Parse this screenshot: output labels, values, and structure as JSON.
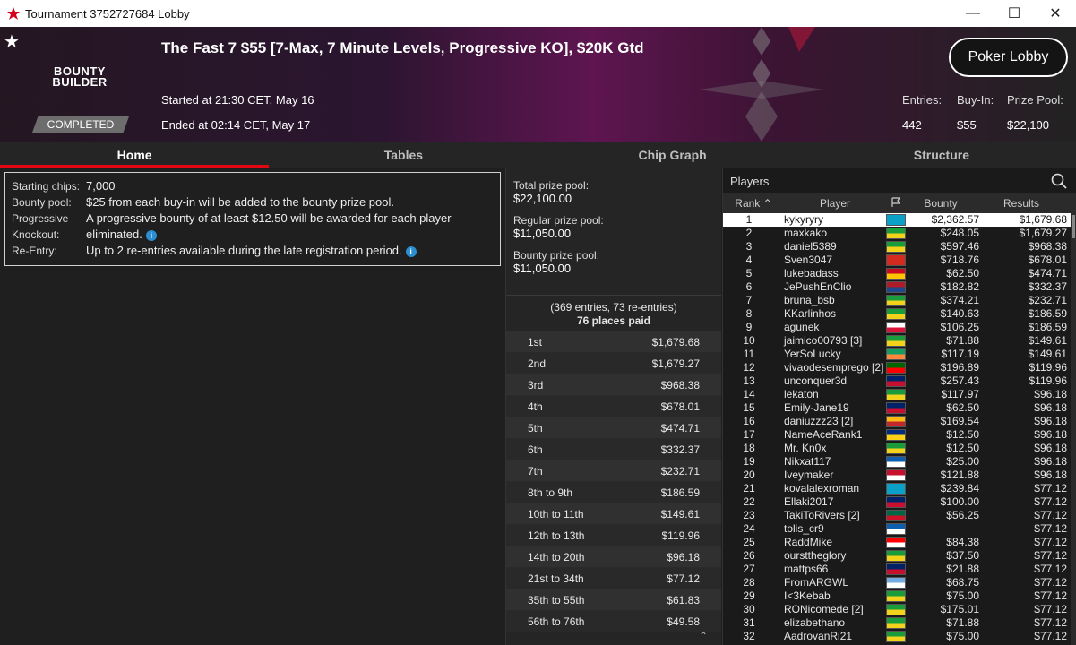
{
  "window": {
    "title": "Tournament 3752727684 Lobby",
    "minimize": "—",
    "maximize": "☐",
    "close": "✕"
  },
  "banner": {
    "favorite": "★",
    "brand_line1": "BOUNTY",
    "brand_line2": "BUILDER",
    "status": "COMPLETED",
    "title": "The Fast 7 $55 [7-Max, 7 Minute Levels, Progressive KO], $20K Gtd",
    "started": "Started at 21:30 CET, May 16",
    "ended": "Ended at 02:14 CET, May 17",
    "lobby_button": "Poker Lobby",
    "stats": {
      "entries_label": "Entries:",
      "buyin_label": "Buy-In:",
      "prize_label": "Prize Pool:",
      "entries": "442",
      "buyin": "$55",
      "prize": "$22,100"
    }
  },
  "tabs": [
    {
      "label": "Home",
      "active": true
    },
    {
      "label": "Tables",
      "active": false
    },
    {
      "label": "Chip Graph",
      "active": false
    },
    {
      "label": "Structure",
      "active": false
    }
  ],
  "info": {
    "starting_label": "Starting chips:",
    "starting_value": "7,000",
    "bounty_label": "Bounty pool:",
    "bounty_value": "$25 from each buy-in will be added to the bounty prize pool.",
    "pko_label_1": "Progressive",
    "pko_label_2": "Knockout:",
    "pko_value": "A progressive bounty of at least $12.50 will be awarded for each player eliminated.",
    "reentry_label": "Re-Entry:",
    "reentry_value": "Up to 2 re-entries available during the late registration period.",
    "info_icon": "i"
  },
  "prize": {
    "total_label": "Total prize pool:",
    "total_value": "$22,100.00",
    "regular_label": "Regular prize pool:",
    "regular_value": "$11,050.00",
    "bounty_label": "Bounty prize pool:",
    "bounty_value": "$11,050.00",
    "entries_note": "(369 entries, 73 re-entries)",
    "places_paid": "76 places paid",
    "scroll_up": "⌃",
    "places": [
      {
        "place": "1st",
        "amount": "$1,679.68"
      },
      {
        "place": "2nd",
        "amount": "$1,679.27"
      },
      {
        "place": "3rd",
        "amount": "$968.38"
      },
      {
        "place": "4th",
        "amount": "$678.01"
      },
      {
        "place": "5th",
        "amount": "$474.71"
      },
      {
        "place": "6th",
        "amount": "$332.37"
      },
      {
        "place": "7th",
        "amount": "$232.71"
      },
      {
        "place": "8th to 9th",
        "amount": "$186.59"
      },
      {
        "place": "10th to 11th",
        "amount": "$149.61"
      },
      {
        "place": "12th to 13th",
        "amount": "$119.96"
      },
      {
        "place": "14th to 20th",
        "amount": "$96.18"
      },
      {
        "place": "21st to 34th",
        "amount": "$77.12"
      },
      {
        "place": "35th to 55th",
        "amount": "$61.83"
      },
      {
        "place": "56th to 76th",
        "amount": "$49.58"
      }
    ]
  },
  "players": {
    "title": "Players",
    "cols": {
      "rank": "Rank",
      "player": "Player",
      "bounty": "Bounty",
      "results": "Results"
    },
    "rows": [
      {
        "rank": "1",
        "name": "kykyryry",
        "bounty": "$2,362.57",
        "result": "$1,679.68",
        "flag": [
          "#0aa0c8",
          "#0aa0c8"
        ]
      },
      {
        "rank": "2",
        "name": "maxkako",
        "bounty": "$248.05",
        "result": "$1,679.27",
        "flag": [
          "#1a9c3a",
          "#f2d21b"
        ]
      },
      {
        "rank": "3",
        "name": "daniel5389",
        "bounty": "$597.46",
        "result": "$968.38",
        "flag": [
          "#1a9c3a",
          "#f2d21b"
        ]
      },
      {
        "rank": "4",
        "name": "Sven3047",
        "bounty": "$718.76",
        "result": "$678.01",
        "flag": [
          "#d52b1e",
          "#d52b1e"
        ]
      },
      {
        "rank": "5",
        "name": "lukebadass",
        "bounty": "$62.50",
        "result": "$474.71",
        "flag": [
          "#c60b1e",
          "#ffc400"
        ]
      },
      {
        "rank": "6",
        "name": "JePushEnClio",
        "bounty": "$182.82",
        "result": "$332.37",
        "flag": [
          "#ae1c28",
          "#21468b"
        ]
      },
      {
        "rank": "7",
        "name": "bruna_bsb",
        "bounty": "$374.21",
        "result": "$232.71",
        "flag": [
          "#1a9c3a",
          "#f2d21b"
        ]
      },
      {
        "rank": "8",
        "name": "KKarlinhos",
        "bounty": "$140.63",
        "result": "$186.59",
        "flag": [
          "#1a9c3a",
          "#f2d21b"
        ]
      },
      {
        "rank": "9",
        "name": "agunek",
        "bounty": "$106.25",
        "result": "$186.59",
        "flag": [
          "#ffffff",
          "#dc143c"
        ]
      },
      {
        "rank": "10",
        "name": "jaimico00793 [3]",
        "bounty": "$71.88",
        "result": "$149.61",
        "flag": [
          "#1a9c3a",
          "#f2d21b"
        ]
      },
      {
        "rank": "11",
        "name": "YerSoLucky",
        "bounty": "$117.19",
        "result": "$149.61",
        "flag": [
          "#169b62",
          "#ff883e"
        ]
      },
      {
        "rank": "12",
        "name": "vivaodesemprego [2]",
        "bounty": "$196.89",
        "result": "$119.96",
        "flag": [
          "#006600",
          "#ff0000"
        ]
      },
      {
        "rank": "13",
        "name": "unconquer3d",
        "bounty": "$257.43",
        "result": "$119.96",
        "flag": [
          "#012169",
          "#c8102e"
        ]
      },
      {
        "rank": "14",
        "name": "lekaton",
        "bounty": "$117.97",
        "result": "$96.18",
        "flag": [
          "#1a9c3a",
          "#f2d21b"
        ]
      },
      {
        "rank": "15",
        "name": "Emily-Jane19",
        "bounty": "$62.50",
        "result": "$96.18",
        "flag": [
          "#012169",
          "#c8102e"
        ]
      },
      {
        "rank": "16",
        "name": "daniuzzz23 [2]",
        "bounty": "$169.54",
        "result": "$96.18",
        "flag": [
          "#fdb913",
          "#c1272d"
        ]
      },
      {
        "rank": "17",
        "name": "NameAceRank1",
        "bounty": "$12.50",
        "result": "$96.18",
        "flag": [
          "#002b7f",
          "#fcd116"
        ]
      },
      {
        "rank": "18",
        "name": "Mr. Kn0x",
        "bounty": "$12.50",
        "result": "$96.18",
        "flag": [
          "#1a9c3a",
          "#f2d21b"
        ]
      },
      {
        "rank": "19",
        "name": "Nikxat117",
        "bounty": "$25.00",
        "result": "$96.18",
        "flag": [
          "#0d5eaf",
          "#ffffff"
        ]
      },
      {
        "rank": "20",
        "name": "Iveymaker",
        "bounty": "$121.88",
        "result": "$96.18",
        "flag": [
          "#c8102e",
          "#ffffff"
        ]
      },
      {
        "rank": "21",
        "name": "kovalalexroman",
        "bounty": "$239.84",
        "result": "$77.12",
        "flag": [
          "#0aa0c8",
          "#0aa0c8"
        ]
      },
      {
        "rank": "22",
        "name": "Ellaki2017",
        "bounty": "$100.00",
        "result": "$77.12",
        "flag": [
          "#012169",
          "#c8102e"
        ]
      },
      {
        "rank": "23",
        "name": "TakiToRivers [2]",
        "bounty": "$56.25",
        "result": "$77.12",
        "flag": [
          "#006847",
          "#ce1126"
        ]
      },
      {
        "rank": "24",
        "name": "tolis_cr9",
        "bounty": "",
        "result": "$77.12",
        "flag": [
          "#0d5eaf",
          "#ffffff"
        ]
      },
      {
        "rank": "25",
        "name": "RaddMike",
        "bounty": "$84.38",
        "result": "$77.12",
        "flag": [
          "#ff0000",
          "#ffffff"
        ]
      },
      {
        "rank": "26",
        "name": "oursttheglory",
        "bounty": "$37.50",
        "result": "$77.12",
        "flag": [
          "#1a9c3a",
          "#f2d21b"
        ]
      },
      {
        "rank": "27",
        "name": "mattps66",
        "bounty": "$21.88",
        "result": "$77.12",
        "flag": [
          "#012169",
          "#c8102e"
        ]
      },
      {
        "rank": "28",
        "name": "FromARGWL",
        "bounty": "$68.75",
        "result": "$77.12",
        "flag": [
          "#74acdf",
          "#ffffff"
        ]
      },
      {
        "rank": "29",
        "name": "I<3Kebab",
        "bounty": "$75.00",
        "result": "$77.12",
        "flag": [
          "#1a9c3a",
          "#f2d21b"
        ]
      },
      {
        "rank": "30",
        "name": "RONicomede [2]",
        "bounty": "$175.01",
        "result": "$77.12",
        "flag": [
          "#1a9c3a",
          "#f2d21b"
        ]
      },
      {
        "rank": "31",
        "name": "elizabethano",
        "bounty": "$71.88",
        "result": "$77.12",
        "flag": [
          "#1a9c3a",
          "#f2d21b"
        ]
      },
      {
        "rank": "32",
        "name": "AadrovanRi21",
        "bounty": "$75.00",
        "result": "$77.12",
        "flag": [
          "#1a9c3a",
          "#f2d21b"
        ]
      }
    ]
  }
}
